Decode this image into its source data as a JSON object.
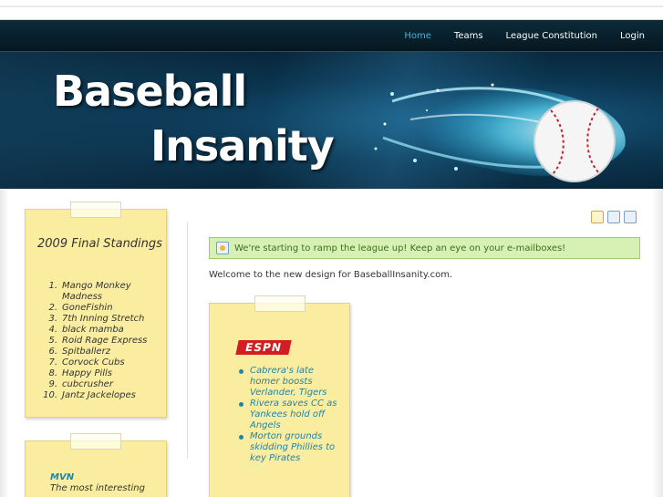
{
  "nav": {
    "items": [
      {
        "label": "Home",
        "active": true
      },
      {
        "label": "Teams",
        "active": false
      },
      {
        "label": "League Constitution",
        "active": false
      },
      {
        "label": "Login",
        "active": false
      }
    ]
  },
  "banner": {
    "title_line1": "Baseball",
    "title_line2": "Insanity"
  },
  "sidebar": {
    "standings_title": "2009 Final Standings",
    "standings": [
      {
        "rank": "1.",
        "team": "Mango Monkey Madness"
      },
      {
        "rank": "2.",
        "team": "GoneFishin"
      },
      {
        "rank": "3.",
        "team": "7th Inning Stretch"
      },
      {
        "rank": "4.",
        "team": "black mamba"
      },
      {
        "rank": "5.",
        "team": "Roid Rage Express"
      },
      {
        "rank": "6.",
        "team": "Spitballerz"
      },
      {
        "rank": "7.",
        "team": "Corvock Cubs"
      },
      {
        "rank": "8.",
        "team": "Happy Pills"
      },
      {
        "rank": "9.",
        "team": "cubcrusher"
      },
      {
        "rank": "10.",
        "team": "Jantz Jackelopes"
      }
    ],
    "mvn_title": "MVN",
    "mvn_text": "The most interesting"
  },
  "main": {
    "alert": "We're starting to ramp the league up! Keep an eye on your e-mailboxes!",
    "welcome": "Welcome to the new design for BaseballInsanity.com."
  },
  "espn": {
    "logo_text": "ESPN",
    "headlines": [
      "Cabrera's late homer boosts Verlander, Tigers",
      "Rivera saves CC as Yankees hold off Angels",
      "Morton grounds skidding Phillies to key Pirates"
    ]
  },
  "colors": {
    "accent_link": "#1f84a9",
    "nav_active": "#3bb7e6",
    "note_yellow": "#faeda0",
    "alert_green": "#d7f1b5"
  }
}
